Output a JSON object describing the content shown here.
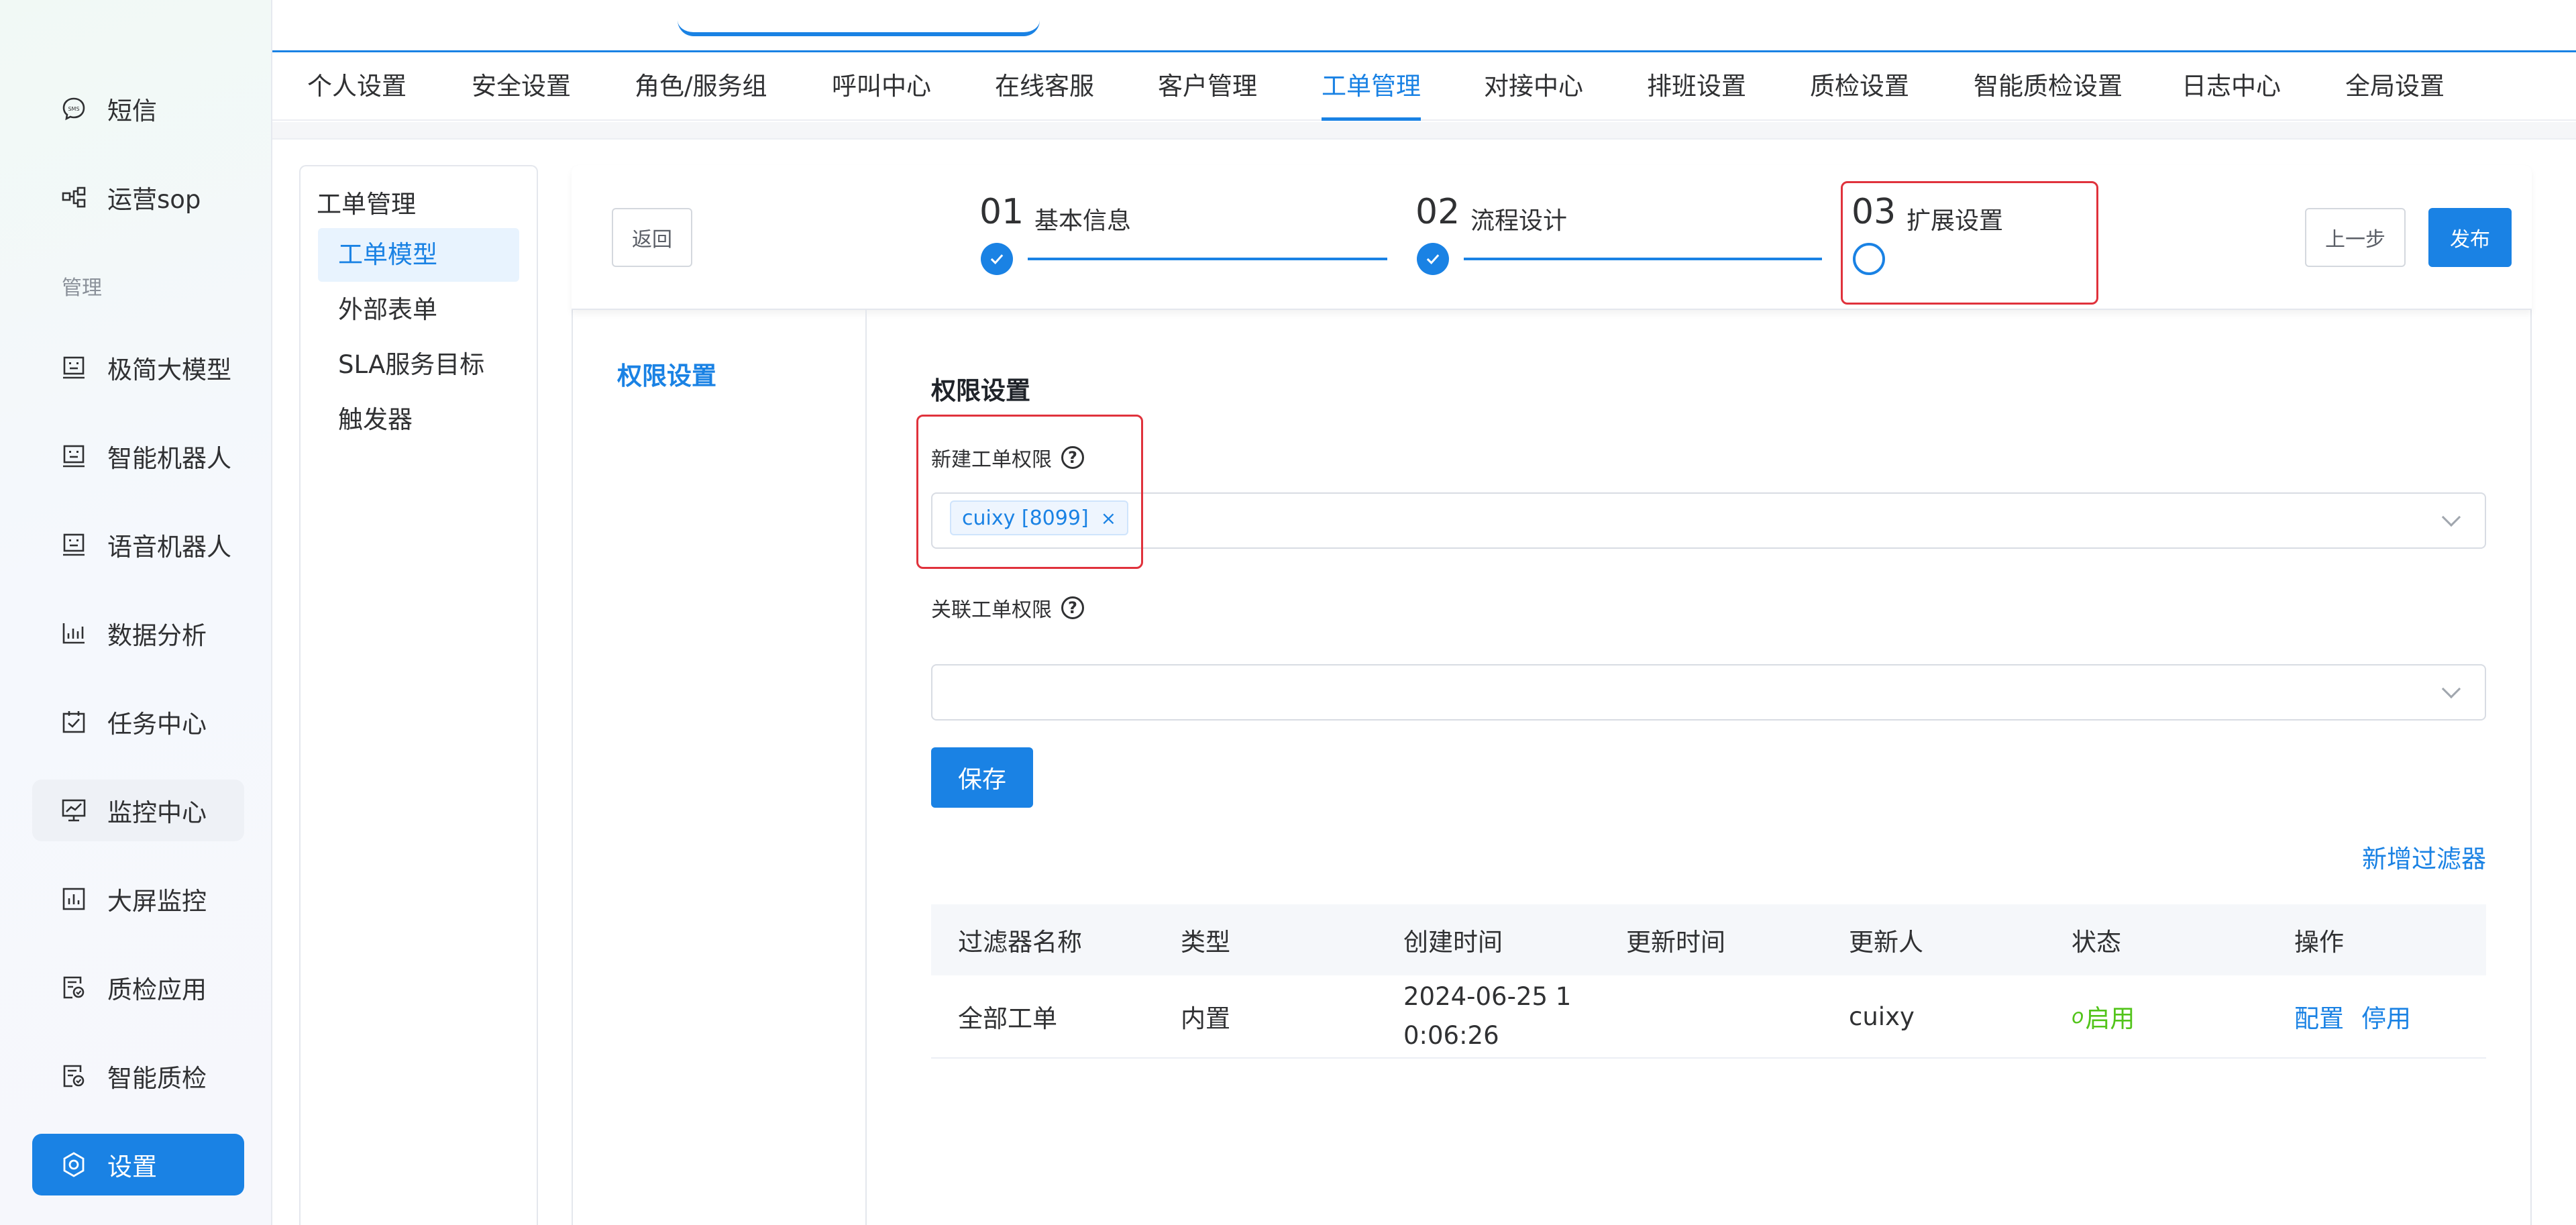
{
  "sidebar": {
    "partial_top_label": "",
    "items": [
      {
        "label": "短信",
        "icon": "sms-icon"
      },
      {
        "label": "运营sop",
        "icon": "flow-icon"
      },
      {
        "label": "极简大模型",
        "icon": "robot-icon"
      },
      {
        "label": "智能机器人",
        "icon": "robot-icon"
      },
      {
        "label": "语音机器人",
        "icon": "robot-icon"
      },
      {
        "label": "数据分析",
        "icon": "bar-chart-icon"
      },
      {
        "label": "任务中心",
        "icon": "task-icon"
      },
      {
        "label": "监控中心",
        "icon": "monitor-icon"
      },
      {
        "label": "大屏监控",
        "icon": "dashboard-icon"
      },
      {
        "label": "质检应用",
        "icon": "inspect-icon"
      },
      {
        "label": "智能质检",
        "icon": "inspect-icon"
      },
      {
        "label": "设置",
        "icon": "settings-icon"
      }
    ],
    "section_manage": "管理"
  },
  "top_tabs": [
    "个人设置",
    "安全设置",
    "角色/服务组",
    "呼叫中心",
    "在线客服",
    "客户管理",
    "工单管理",
    "对接中心",
    "排班设置",
    "质检设置",
    "智能质检设置",
    "日志中心",
    "全局设置"
  ],
  "active_tab": "工单管理",
  "sub_menu": {
    "title": "工单管理",
    "items": [
      "工单模型",
      "外部表单",
      "SLA服务目标",
      "触发器"
    ]
  },
  "toolbar": {
    "back_label": "返回",
    "prev_label": "上一步",
    "publish_label": "发布"
  },
  "steps": [
    {
      "num": "01",
      "label": "基本信息",
      "state": "done"
    },
    {
      "num": "02",
      "label": "流程设计",
      "state": "done"
    },
    {
      "num": "03",
      "label": "扩展设置",
      "state": "current"
    }
  ],
  "side_nav": {
    "permission": "权限设置"
  },
  "form": {
    "section_title": "权限设置",
    "new_perm_label": "新建工单权限",
    "new_perm_tag": "cuixy [8099]",
    "link_perm_label": "关联工单权限",
    "save_label": "保存",
    "add_filter_label": "新增过滤器"
  },
  "table": {
    "headers": [
      "过滤器名称",
      "类型",
      "创建时间",
      "更新时间",
      "更新人",
      "状态",
      "操作"
    ],
    "rows": [
      {
        "name": "全部工单",
        "type": "内置",
        "created_line1": "2024-06-25 1",
        "created_line2": "0:06:26",
        "updated": "",
        "updater": "cuixy",
        "status": "启用",
        "action_config": "配置",
        "action_disable": "停用"
      }
    ]
  },
  "colors": {
    "accent": "#1a82e4",
    "highlight_box": "#e0323c",
    "status_enabled": "#52c41a"
  }
}
